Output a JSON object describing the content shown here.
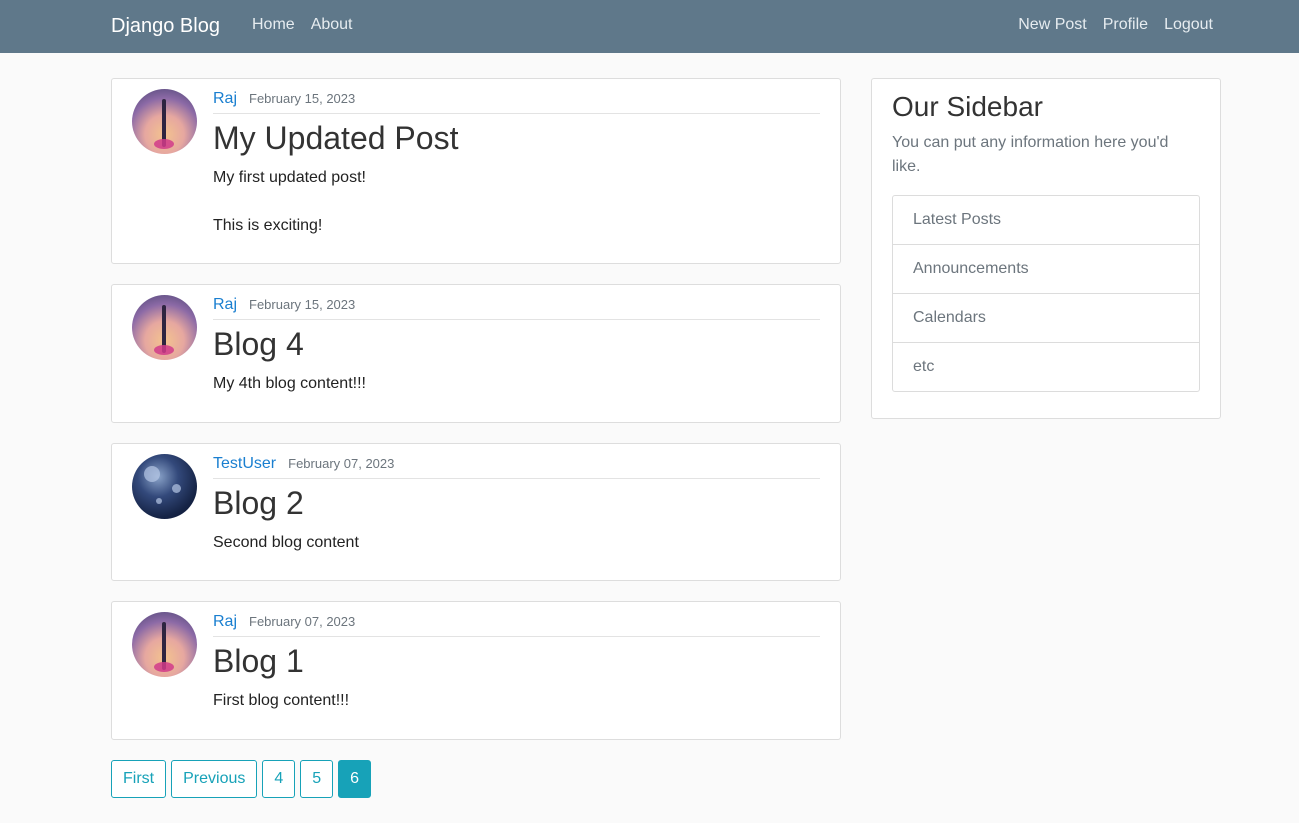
{
  "navbar": {
    "brand": "Django Blog",
    "left_links": [
      "Home",
      "About"
    ],
    "right_links": [
      "New Post",
      "Profile",
      "Logout"
    ]
  },
  "posts": [
    {
      "author": "Raj",
      "date": "February 15, 2023",
      "title": "My Updated Post",
      "content": "My first updated post!\n\nThis is exciting!",
      "avatar": "raj-avatar"
    },
    {
      "author": "Raj",
      "date": "February 15, 2023",
      "title": "Blog 4",
      "content": "My 4th blog content!!!",
      "avatar": "raj-avatar"
    },
    {
      "author": "TestUser",
      "date": "February 07, 2023",
      "title": "Blog 2",
      "content": "Second blog content",
      "avatar": "testuser-avatar"
    },
    {
      "author": "Raj",
      "date": "February 07, 2023",
      "title": "Blog 1",
      "content": "First blog content!!!",
      "avatar": "raj-avatar"
    }
  ],
  "pagination": {
    "buttons": [
      "First",
      "Previous",
      "4",
      "5",
      "6"
    ],
    "active": "6"
  },
  "sidebar": {
    "title": "Our Sidebar",
    "description": "You can put any information here you'd like.",
    "items": [
      "Latest Posts",
      "Announcements",
      "Calendars",
      "etc"
    ]
  },
  "colors": {
    "navbar_bg": "#5f788a",
    "link": "#1a7fd0",
    "accent": "#17a2b8"
  }
}
